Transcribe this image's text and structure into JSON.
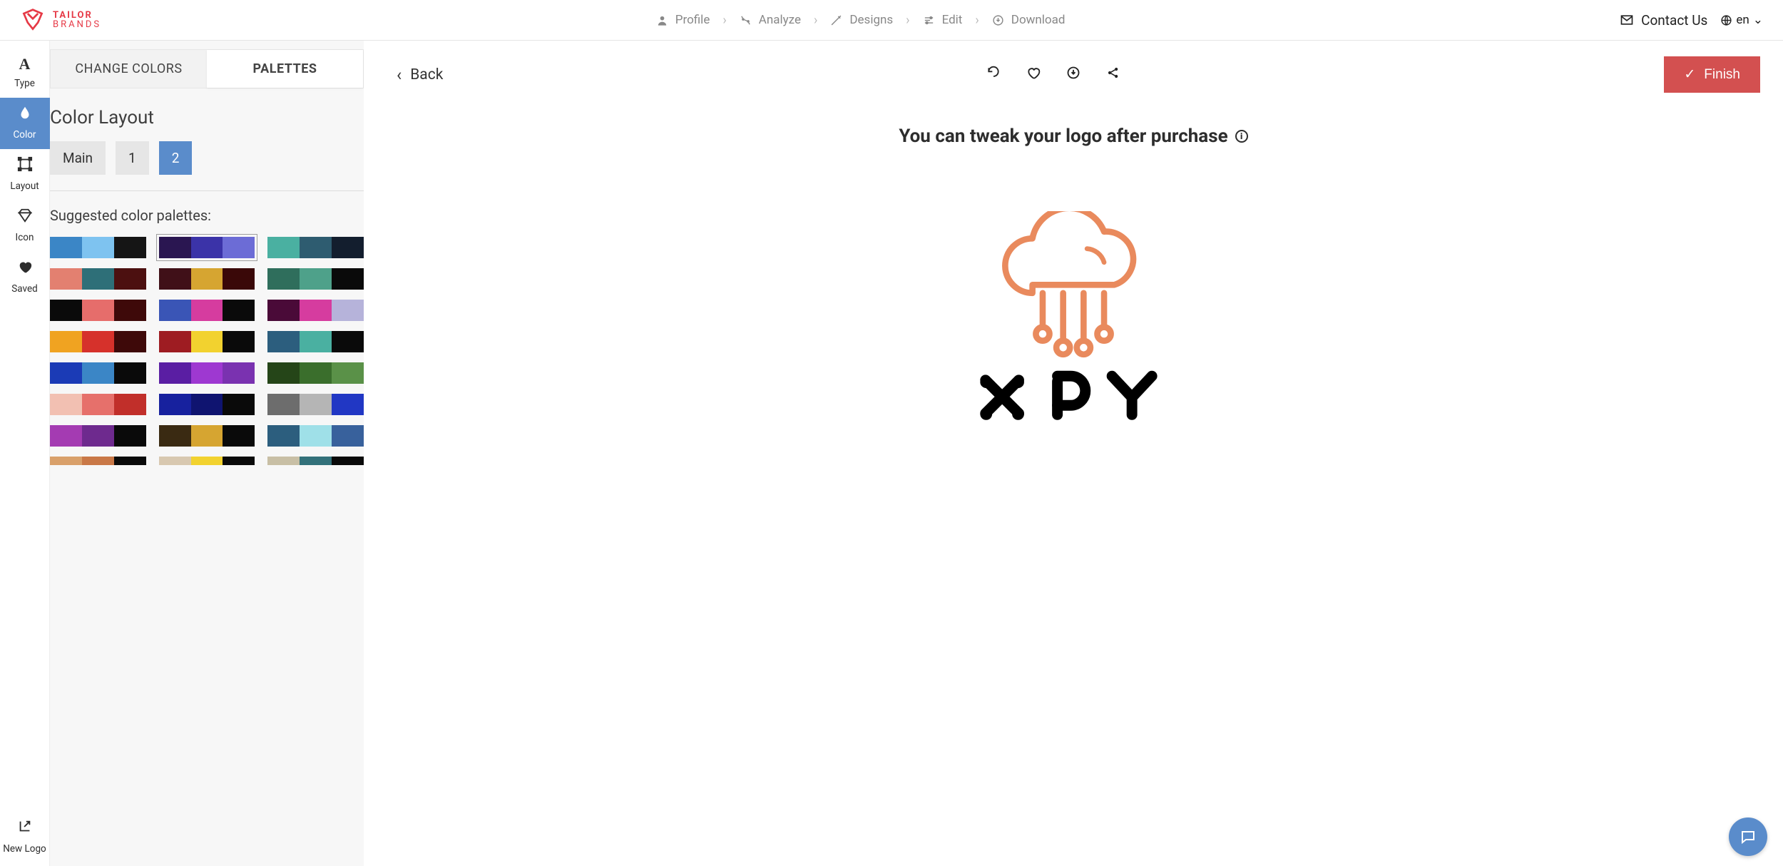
{
  "brand": {
    "line1": "TAILOR",
    "line2": "BRANDS"
  },
  "nav": {
    "steps": [
      {
        "icon": "profile-icon",
        "label": "Profile"
      },
      {
        "icon": "analyze-icon",
        "label": "Analyze"
      },
      {
        "icon": "designs-icon",
        "label": "Designs"
      },
      {
        "icon": "edit-icon",
        "label": "Edit"
      },
      {
        "icon": "download-icon",
        "label": "Download"
      }
    ],
    "contact_label": "Contact Us",
    "lang_label": "en"
  },
  "rail": {
    "items": [
      {
        "key": "type",
        "label": "Type"
      },
      {
        "key": "color",
        "label": "Color"
      },
      {
        "key": "layout",
        "label": "Layout"
      },
      {
        "key": "icon",
        "label": "Icon"
      },
      {
        "key": "saved",
        "label": "Saved"
      }
    ],
    "active": "color",
    "new_logo_label": "New Logo"
  },
  "sidebar": {
    "tabs": {
      "change_colors": "CHANGE COLORS",
      "palettes": "PALETTES",
      "active": "palettes"
    },
    "color_layout_title": "Color Layout",
    "layout_options": {
      "main": "Main",
      "one": "1",
      "two": "2",
      "active": "two"
    },
    "suggested_title": "Suggested color palettes:",
    "selected_palette_index": 1,
    "palettes": [
      [
        "#3b86c6",
        "#7ec3f0",
        "#151515"
      ],
      [
        "#2a1651",
        "#3b33a8",
        "#6c6cd6"
      ],
      [
        "#4ab0a1",
        "#2e5c70",
        "#131e2e"
      ],
      [
        "#e38070",
        "#2e6f78",
        "#4c1010"
      ],
      [
        "#401018",
        "#d6a531",
        "#3a0808"
      ],
      [
        "#2f6e5c",
        "#4ea18a",
        "#0a0a0a"
      ],
      [
        "#0a0a0a",
        "#e66d6b",
        "#3e0909"
      ],
      [
        "#3a55b6",
        "#d63c9f",
        "#0a0a0a"
      ],
      [
        "#4a0a38",
        "#d63c9f",
        "#b6b3da"
      ],
      [
        "#f0a321",
        "#d6312b",
        "#3e0909"
      ],
      [
        "#9e1c22",
        "#f2d22f",
        "#0a0a0a"
      ],
      [
        "#2c5e7e",
        "#4ab0a1",
        "#0a0a0a"
      ],
      [
        "#1b3bb6",
        "#3b86c6",
        "#0a0a0a"
      ],
      [
        "#5a1ea3",
        "#9e38d1",
        "#7a32b0"
      ],
      [
        "#254518",
        "#3a6e2c",
        "#5a9148"
      ],
      [
        "#f2c0b2",
        "#e6706b",
        "#c12f2a"
      ],
      [
        "#17219e",
        "#0f1470",
        "#0a0a0a"
      ],
      [
        "#6d6d6d",
        "#b5b5b5",
        "#2137c4"
      ],
      [
        "#a43bb2",
        "#6e2a8e",
        "#0a0a0a"
      ],
      [
        "#3a2a12",
        "#d6a531",
        "#0a0a0a"
      ],
      [
        "#2c5e7e",
        "#9fe0e8",
        "#38619c"
      ]
    ],
    "partial_palettes": [
      [
        "#d9a06a",
        "#c97847",
        "#0a0a0a"
      ],
      [
        "#d8c8b0",
        "#f2d22f",
        "#0a0a0a"
      ],
      [
        "#c8bfa5",
        "#33717a",
        "#0a0a0a"
      ]
    ]
  },
  "canvas": {
    "back_label": "Back",
    "finish_label": "Finish",
    "headline": "You can tweak your logo after purchase",
    "logo_text": "XPY",
    "accent_color": "#e98a5d"
  }
}
